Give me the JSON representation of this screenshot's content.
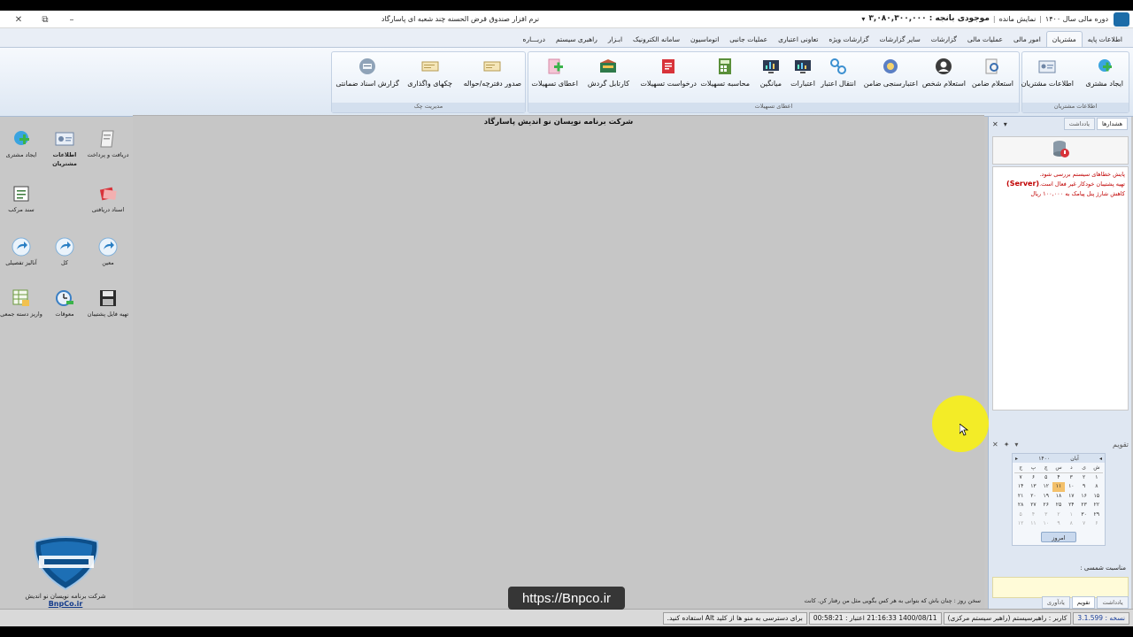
{
  "window": {
    "title": "نرم افزار صندوق قرض الحسنه چند شعبه ای پاسارگاد",
    "close": "✕",
    "restore": "⧉",
    "minimize": "–",
    "status": {
      "period": "دوره مالی سال ۱۴۰۰",
      "session": "نمایش مانده",
      "balance": "موجودی بانجه : ۳,۰۸۰,۳۰۰,۰۰۰",
      "dropdown": "▾"
    }
  },
  "menu": {
    "tabs": [
      "اطلاعات پایه",
      "مشتریان",
      "امور مالی",
      "عملیات مالی",
      "گزارشات",
      "سایر گزارشات",
      "گزارشات ویژه",
      "تعاونی اعتباری",
      "عملیات جانبی",
      "اتوماسیون",
      "سامانه الکترونیک",
      "ابـزار",
      "راهبری سیستم",
      "دربـــاره"
    ],
    "active_index": 1
  },
  "ribbon": {
    "groups": [
      {
        "title": "اطلاعات مشتریان",
        "buttons": [
          "ایجاد مشتری",
          "اطلاعات مشتریان"
        ]
      },
      {
        "title": "اعطای تسهیلات",
        "buttons": [
          "استعلام ضامن",
          "استعلام شخص",
          "اعتبارسنجی ضامن",
          "انتقال اعتبار",
          "اعتبارات",
          "میانگین",
          "محاسبه تسهیلات",
          "درخواست تسهیلات",
          "کارتابل گردش",
          "اعطای تسهیلات"
        ]
      },
      {
        "title": "مدیریت چک",
        "buttons": [
          "صدور دفترچه/حواله",
          "چکهای واگذاری",
          "گزارش اسناد ضمانتی"
        ]
      }
    ]
  },
  "left_panel": {
    "tiles": {
      "receive_pay": "دریافت و پرداخت",
      "customer_info": "اطلاعات مشتریان",
      "create_customer": "ایجاد مشتری",
      "received_docs": "اسناد دریافتی",
      "composite_doc": "سند مرکب",
      "moein": "معین",
      "kol": "کل",
      "tafsili": "آنالیز تفصیلی",
      "backup": "تهیه فایل پشتیبان",
      "pending": "معوقات",
      "bulk_deposit": "واریز دسته جمعی"
    },
    "brand": {
      "logo_text": "پاسارگاد",
      "company": "شرکت برنامه نویسان نو اندیش",
      "site": "BnpCo.ir"
    }
  },
  "workspace": {
    "title": "شرکت برنامه نویسان نو اندیش پاسارگاد",
    "quote": "سخن روز : چنان باش که بتوانی به هر کس بگویی مثل من رفتار کن. کانت"
  },
  "right_panel": {
    "tabs": [
      "هشدارها",
      "یادداشت"
    ],
    "messages": [
      "پایش خطاهای سیستم بررسی شود.",
      "تهیه پشتیبان خودکار غیر فعال است.",
      "(Server)",
      "کاهش شارژ پنل پیامک به ۱۰۰,۰۰۰ ریال"
    ],
    "calendar_title": "تقویم",
    "calendar": {
      "month": "آبان",
      "year": "۱۴۰۰",
      "weekdays": [
        "ش",
        "ی",
        "د",
        "س",
        "چ",
        "پ",
        "ج"
      ],
      "days": [
        "۱",
        "۲",
        "۳",
        "۴",
        "۵",
        "۶",
        "۷",
        "۸",
        "۹",
        "۱۰",
        "۱۱",
        "۱۲",
        "۱۳",
        "۱۴",
        "۱۵",
        "۱۶",
        "۱۷",
        "۱۸",
        "۱۹",
        "۲۰",
        "۲۱",
        "۲۲",
        "۲۳",
        "۲۴",
        "۲۵",
        "۲۶",
        "۲۷",
        "۲۸",
        "۲۹",
        "۳۰",
        "۱",
        "۲",
        "۳",
        "۴",
        "۵",
        "۶",
        "۷",
        "۸",
        "۹",
        "۱۰",
        "۱۱",
        "۱۲"
      ],
      "today_index": 10,
      "today_button": "امروز"
    },
    "occasion_label": "مناسبت شمسی :",
    "bottom_tabs": [
      "یادداشت",
      "تقویم",
      "یادآوری"
    ]
  },
  "statusbar": {
    "version": "نسخه : 3.1.599",
    "user": "کاربر : راهبرسیستم (راهبر سیستم مرکزی)",
    "datetime": "1400/08/11 21:16:33 اعتبار : 00:58:21",
    "hint": "برای دسترسی به منو ها از کلید Alt استفاده کنید."
  },
  "watermark": "https://Bnpco.ir",
  "colors": {
    "accent": "#1c6ca8",
    "alert": "#c00000",
    "ribbon_top": "#f6f9fd",
    "cursor_highlight": "#f6ee1f"
  }
}
